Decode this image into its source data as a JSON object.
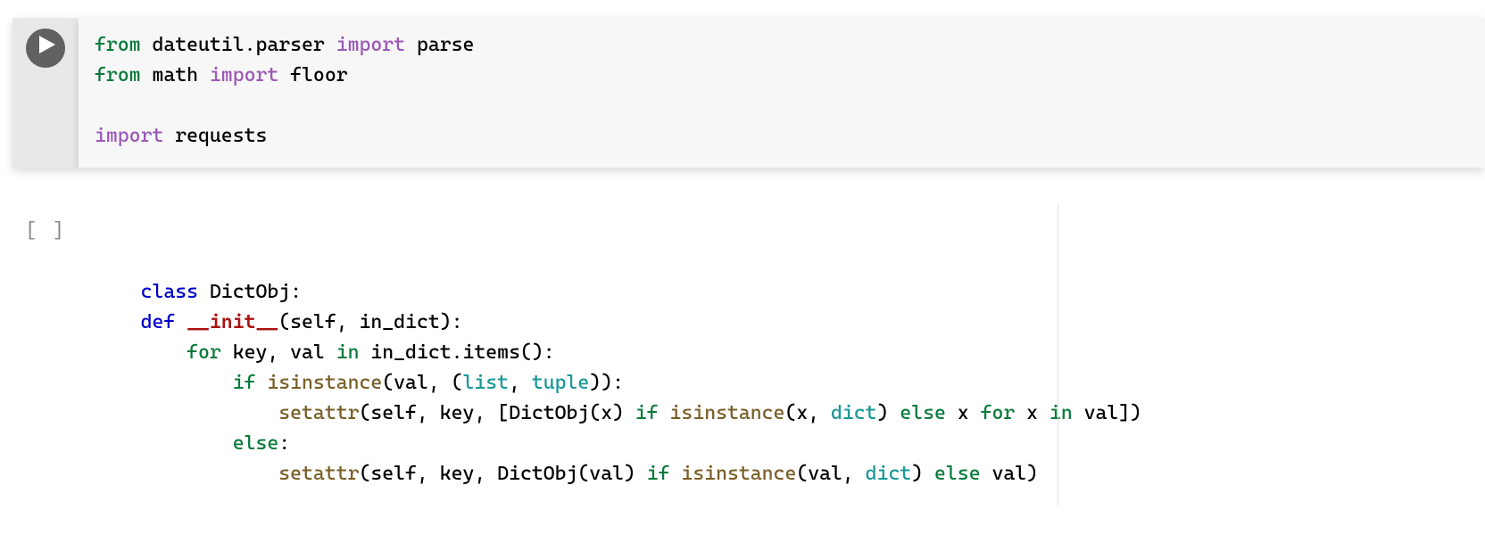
{
  "cells": [
    {
      "state": "active",
      "exec_count": null,
      "code_tokens": [
        [
          [
            "from",
            "kw2"
          ],
          [
            " dateutil",
            "name"
          ],
          [
            ".",
            "name"
          ],
          [
            "parser ",
            "name"
          ],
          [
            "import",
            "kw"
          ],
          [
            " parse",
            "name"
          ]
        ],
        [
          [
            "from",
            "kw2"
          ],
          [
            " math ",
            "name"
          ],
          [
            "import",
            "kw"
          ],
          [
            " floor",
            "name"
          ]
        ],
        [
          [
            "",
            "name"
          ]
        ],
        [
          [
            "import",
            "kw"
          ],
          [
            " requests",
            "name"
          ]
        ]
      ]
    },
    {
      "state": "idle",
      "exec_count": "[ ]",
      "code_tokens": [
        [
          [
            "class",
            "def"
          ],
          [
            " DictObj:",
            "name"
          ]
        ],
        [
          [
            "    ",
            "name"
          ],
          [
            "def",
            "def"
          ],
          [
            " ",
            "name"
          ],
          [
            "__init__",
            "dunder"
          ],
          [
            "(",
            "name"
          ],
          [
            "self, in_dict):",
            "name"
          ]
        ],
        [
          [
            "        ",
            "name"
          ],
          [
            "for",
            "kw2"
          ],
          [
            " key, val ",
            "name"
          ],
          [
            "in",
            "kw2"
          ],
          [
            " in_dict.items():",
            "name"
          ]
        ],
        [
          [
            "            ",
            "name"
          ],
          [
            "if",
            "kw2"
          ],
          [
            " ",
            "name"
          ],
          [
            "isinstance",
            "fn"
          ],
          [
            "(val, (",
            "name"
          ],
          [
            "list",
            "builtin"
          ],
          [
            ", ",
            "name"
          ],
          [
            "tuple",
            "builtin"
          ],
          [
            ")):",
            "name"
          ]
        ],
        [
          [
            "                ",
            "name"
          ],
          [
            "setattr",
            "fn"
          ],
          [
            "(",
            "name"
          ],
          [
            "self, key, [DictObj(x) ",
            "name"
          ],
          [
            "if",
            "kw2"
          ],
          [
            " ",
            "name"
          ],
          [
            "isinstance",
            "fn"
          ],
          [
            "(x, ",
            "name"
          ],
          [
            "dict",
            "builtin"
          ],
          [
            ") ",
            "name"
          ],
          [
            "else",
            "kw2"
          ],
          [
            " x ",
            "name"
          ],
          [
            "for",
            "kw2"
          ],
          [
            " x ",
            "name"
          ],
          [
            "in",
            "kw2"
          ],
          [
            " val])",
            "name"
          ]
        ],
        [
          [
            "            ",
            "name"
          ],
          [
            "else",
            "kw2"
          ],
          [
            ":",
            "name"
          ]
        ],
        [
          [
            "                ",
            "name"
          ],
          [
            "setattr",
            "fn"
          ],
          [
            "(",
            "name"
          ],
          [
            "self, key, DictObj(val) ",
            "name"
          ],
          [
            "if",
            "kw2"
          ],
          [
            " ",
            "name"
          ],
          [
            "isinstance",
            "fn"
          ],
          [
            "(val, ",
            "name"
          ],
          [
            "dict",
            "builtin"
          ],
          [
            ") ",
            "name"
          ],
          [
            "else",
            "kw2"
          ],
          [
            " val)",
            "name"
          ]
        ]
      ]
    }
  ]
}
